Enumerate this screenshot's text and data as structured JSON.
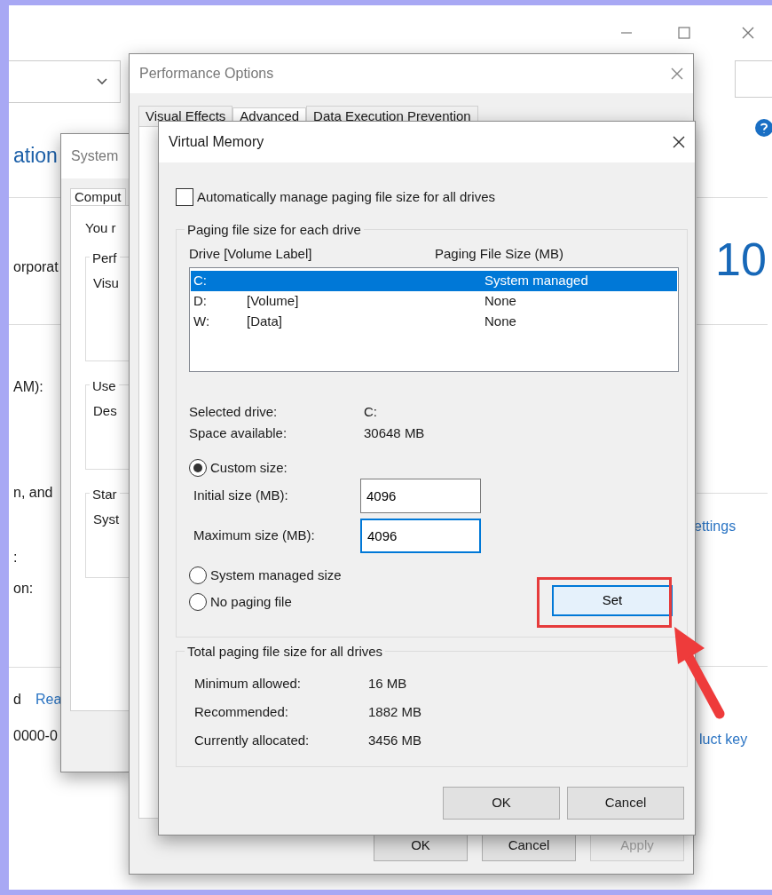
{
  "background_window": {
    "left_texts": [
      {
        "text": "ation",
        "kind": "heading"
      },
      {
        "text": "orporat",
        "kind": "label"
      },
      {
        "text": "AM):",
        "kind": "label"
      },
      {
        "text": "n, and",
        "kind": "label"
      },
      {
        "text": ":",
        "kind": "label"
      },
      {
        "text": "on:",
        "kind": "label"
      },
      {
        "text": "d",
        "kind": "label"
      },
      {
        "text": "Rea",
        "kind": "link"
      },
      {
        "text": "0000-0",
        "kind": "label"
      }
    ],
    "right_texts": [
      {
        "text": "10",
        "kind": "logo"
      },
      {
        "text": "ettings",
        "kind": "link"
      },
      {
        "text": "luct key",
        "kind": "link"
      }
    ]
  },
  "system_window": {
    "title": "System",
    "tab": "Comput",
    "intro": "You r",
    "groups": [
      {
        "title": "Perf",
        "text": "Visu"
      },
      {
        "title": "Use",
        "text": "Des"
      },
      {
        "title": "Star",
        "text": "Syst"
      }
    ]
  },
  "performance_options": {
    "title": "Performance Options",
    "tabs": [
      {
        "label": "Visual Effects",
        "selected": false
      },
      {
        "label": "Advanced",
        "selected": true
      },
      {
        "label": "Data Execution Prevention",
        "selected": false
      }
    ],
    "buttons": [
      {
        "label": "OK",
        "disabled": false
      },
      {
        "label": "Cancel",
        "disabled": false
      },
      {
        "label": "Apply",
        "disabled": true
      }
    ]
  },
  "virtual_memory": {
    "title": "Virtual Memory",
    "auto_manage": {
      "label": "Automatically manage paging file size for all drives",
      "checked": false
    },
    "drives_group": {
      "title": "Paging file size for each drive",
      "columns": [
        "Drive  [Volume Label]",
        "Paging File Size (MB)"
      ],
      "drives": [
        {
          "drive": "C:",
          "size": "System managed",
          "selected": true
        },
        {
          "drive": "D:",
          "label": "[Volume]",
          "size": "None",
          "selected": false
        },
        {
          "drive": "W:",
          "label": "[Data]",
          "size": "None",
          "selected": false
        }
      ],
      "info": [
        {
          "label": "Selected drive:",
          "value": "C:"
        },
        {
          "label": "Space available:",
          "value": "30648 MB"
        }
      ],
      "options": [
        {
          "label": "Custom size:",
          "selected": true
        },
        {
          "label": "System managed size",
          "selected": false
        },
        {
          "label": "No paging file",
          "selected": false
        }
      ],
      "fields": [
        {
          "label": "Initial size (MB):",
          "value": "4096",
          "focused": false
        },
        {
          "label": "Maximum size (MB):",
          "value": "4096",
          "focused": true
        }
      ],
      "set_button": "Set"
    },
    "totals_group": {
      "title": "Total paging file size for all drives",
      "rows": [
        {
          "label": "Minimum allowed:",
          "value": "16 MB"
        },
        {
          "label": "Recommended:",
          "value": "1882 MB"
        },
        {
          "label": "Currently allocated:",
          "value": "3456 MB"
        }
      ]
    },
    "buttons": [
      "OK",
      "Cancel"
    ]
  },
  "annotation": {
    "kind": "highlight-arrow"
  }
}
